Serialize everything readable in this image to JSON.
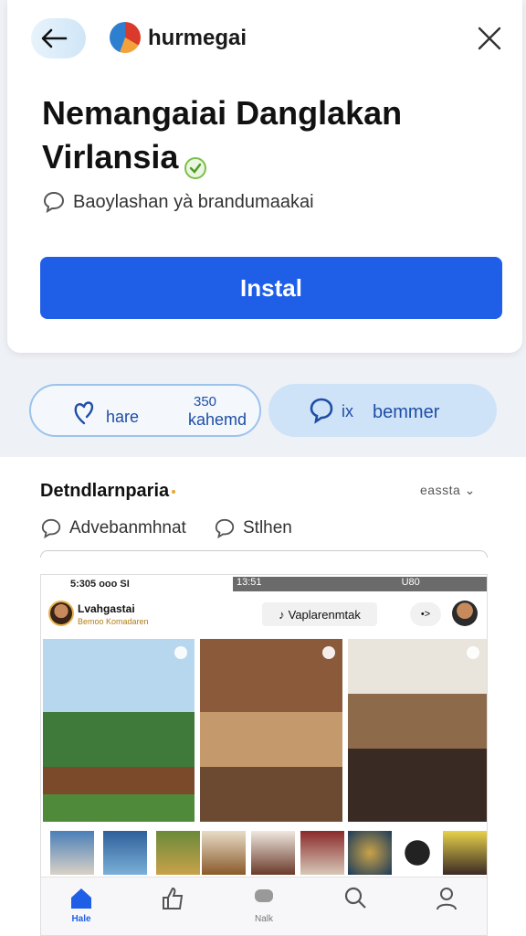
{
  "header": {
    "app_name": "hurmegai",
    "back_icon": "arrow-left-icon",
    "close_icon": "close-icon"
  },
  "app": {
    "title_line1": "Nemangaiai Danglakan",
    "title_line2": "Virlansia",
    "verified_icon": "verified-check-icon",
    "subtitle": "Baoylashan yà brandumaakai",
    "install_label": "Instal",
    "accent_color": "#1f5fe8"
  },
  "actions": {
    "left": {
      "icon": "heart-icon",
      "label1": "hare",
      "count": "350",
      "label2": "kahemd"
    },
    "right": {
      "icon": "chat-icon",
      "x_label": "ix",
      "label": "bemmer"
    }
  },
  "section": {
    "title": "Detndlarnparia",
    "sort_label": "eassta",
    "filters": [
      {
        "icon": "comment-icon",
        "label": "Advebanmhnat"
      },
      {
        "icon": "comment-icon",
        "label": "Stlhen"
      }
    ]
  },
  "screenshot": {
    "status_left": "5:305 ooo SI",
    "status_right": "13:51",
    "status_battery": "U80",
    "profile_name": "Lvahgastai",
    "profile_sub": "Bemoo  Komadaren",
    "chip_label": "Vaplarenmtak",
    "more_label": "•>",
    "nav": [
      {
        "icon": "home-icon",
        "label": "Hale",
        "active": true
      },
      {
        "icon": "thumbs-up-icon",
        "label": ""
      },
      {
        "icon": "chat-bubble-icon",
        "label": "Nalk"
      },
      {
        "icon": "search-icon",
        "label": ""
      },
      {
        "icon": "profile-icon",
        "label": ""
      }
    ]
  }
}
